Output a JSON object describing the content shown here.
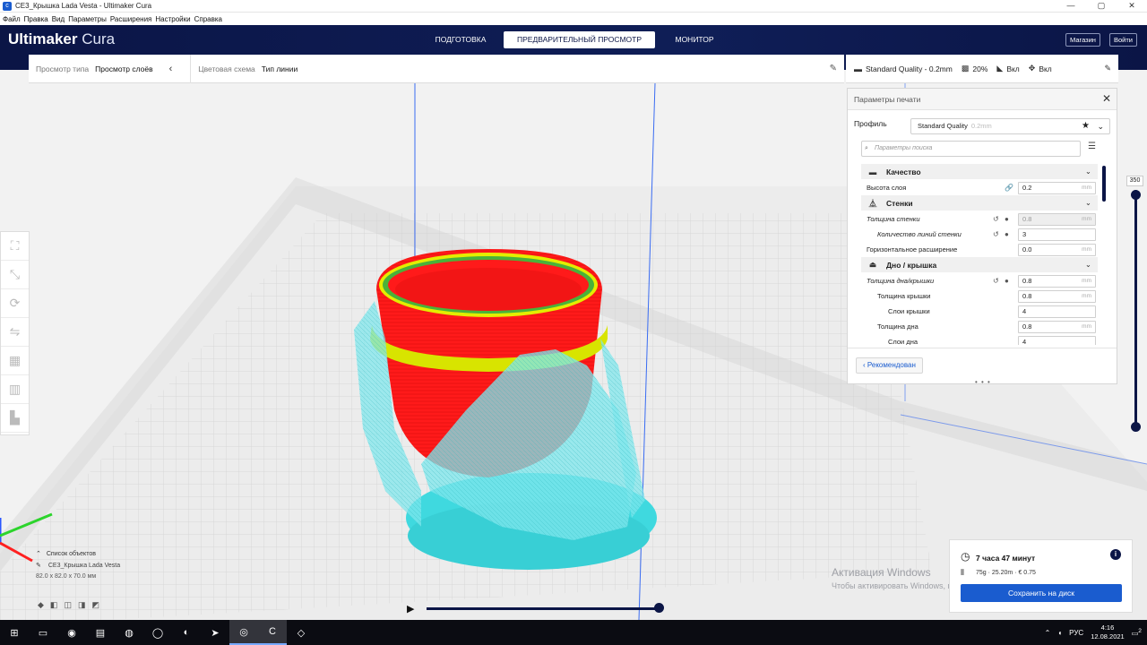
{
  "window": {
    "title": "CE3_Крышка Lada Vesta - Ultimaker Cura",
    "minimize": "—",
    "maximize": "▢",
    "close": "✕"
  },
  "menu": [
    "Файл",
    "Правка",
    "Вид",
    "Параметры",
    "Расширения",
    "Настройки",
    "Справка"
  ],
  "header": {
    "logo_bold": "Ultimaker",
    "logo_light": "Cura",
    "tabs": [
      "ПОДГОТОВКА",
      "ПРЕДВАРИТЕЛЬНЫЙ ПРОСМОТР",
      "МОНИТОР"
    ],
    "active_tab": "ПРЕДВАРИТЕЛЬНЫЙ ПРОСМОТР",
    "market_label": "Магазин",
    "login_label": "Войти"
  },
  "view_bar": {
    "view_type_label": "Просмотр типа",
    "view_type_value": "Просмотр слоёв",
    "color_scheme_label": "Цветовая схема",
    "color_scheme_value": "Тип линии"
  },
  "settings_bar": {
    "profile": "Standard Quality - 0.2mm",
    "infill": "20%",
    "support": "Вкл",
    "adhesion": "Вкл"
  },
  "panel": {
    "title": "Параметры печати",
    "profile_label": "Профиль",
    "profile_value": "Standard Quality",
    "profile_sub": "0.2mm",
    "search_placeholder": "Параметры поиска",
    "recommended_label": "Рекомендован",
    "grip": "• • •",
    "categories": [
      {
        "name": "Качество",
        "rows": [
          {
            "name": "Высота слоя",
            "value": "0.2",
            "unit": "mm"
          }
        ]
      },
      {
        "name": "Стенки",
        "rows": [
          {
            "name": "Толщина стенки",
            "value": "0.8",
            "unit": "mm"
          },
          {
            "name": "Количество линий стенки",
            "value": "3",
            "unit": ""
          },
          {
            "name": "Горизонтальное расширение",
            "value": "0.0",
            "unit": "mm"
          }
        ]
      },
      {
        "name": "Дно / крышка",
        "rows": [
          {
            "name": "Толщина дна/крышки",
            "value": "0.8",
            "unit": "mm"
          },
          {
            "name": "Толщина крышки",
            "value": "0.8",
            "unit": "mm"
          },
          {
            "name": "Слои крышки",
            "value": "4",
            "unit": ""
          },
          {
            "name": "Толщина дна",
            "value": "0.8",
            "unit": "mm"
          },
          {
            "name": "Слои дна",
            "value": "4",
            "unit": ""
          }
        ]
      }
    ]
  },
  "layer_slider": {
    "top_value": "350"
  },
  "objects": {
    "header": "Список объектов",
    "name": "CE3_Крышка Lada Vesta",
    "dimensions": "82.0 x 82.0 x 70.0 мм"
  },
  "output": {
    "time": "7 часа 47 минут",
    "material": "75g · 25.20m · € 0.75",
    "save_label": "Сохранить на диск"
  },
  "activation": {
    "title": "Активация Windows",
    "text": "Чтобы активировать Windows, перейдите в раздел \"Параметры\"."
  },
  "tray": {
    "lang": "РУС",
    "time": "4:16",
    "date": "12.08.2021",
    "notifications": "2"
  },
  "colors": {
    "header_bg": "#0b1546",
    "accent": "#1a5ccf",
    "model_red": "#ff1a1a",
    "support_cyan": "#5fe0e6",
    "skin_yellow": "#d8e400"
  }
}
